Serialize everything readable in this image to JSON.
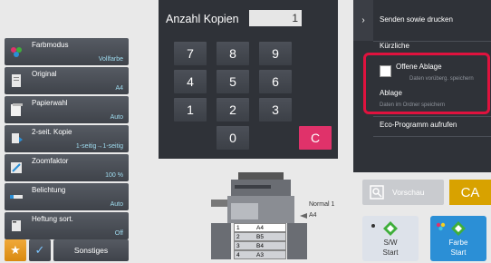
{
  "settings": [
    {
      "label": "Farbmodus",
      "value": "Vollfarbe",
      "icon": "color-mode-icon"
    },
    {
      "label": "Original",
      "value": "A4",
      "icon": "original-icon"
    },
    {
      "label": "Papierwahl",
      "value": "Auto",
      "icon": "paper-select-icon"
    },
    {
      "label": "2-seit. Kopie",
      "value": "1-seitig→1-seitig",
      "icon": "duplex-icon"
    },
    {
      "label": "Zoomfaktor",
      "value": "100 %",
      "icon": "zoom-icon"
    },
    {
      "label": "Belichtung",
      "value": "Auto",
      "icon": "exposure-icon"
    },
    {
      "label": "Heftung sort.",
      "value": "Off",
      "icon": "staple-sort-icon"
    }
  ],
  "bottom_left": {
    "others_label": "Sonstiges"
  },
  "keypad": {
    "title": "Anzahl Kopien",
    "display_value": "1",
    "keys": [
      "7",
      "8",
      "9",
      "4",
      "5",
      "6",
      "1",
      "2",
      "3",
      "0"
    ],
    "clear_label": "C"
  },
  "right_panel": {
    "send_print": "Senden sowie drucken",
    "recent": "Kürzliche",
    "temp_storage": "Offene Ablage",
    "temp_storage_sub": "Daten vorüberg. speichern",
    "storage": "Ablage",
    "storage_sub": "Daten im Ordner speichern",
    "eco": "Eco-Programm aufrufen"
  },
  "preview": {
    "label": "Vorschau"
  },
  "ca": {
    "label": "CA"
  },
  "start_bw": {
    "line1": "S/W",
    "line2": "Start"
  },
  "start_color": {
    "line1": "Farbe",
    "line2": "Start"
  },
  "printer": {
    "output_label": "Normal 1",
    "bypass_label": "A4",
    "trays": [
      {
        "num": "1",
        "size": "A4"
      },
      {
        "num": "2",
        "size": "B5"
      },
      {
        "num": "3",
        "size": "B4"
      },
      {
        "num": "4",
        "size": "A3"
      }
    ]
  },
  "colors": {
    "accent_green": "#3fae3b",
    "clear_pink": "#e0326a",
    "ca_yellow": "#d8a200",
    "highlight_red": "#e0123e",
    "value_cyan": "#9fdcf0"
  }
}
